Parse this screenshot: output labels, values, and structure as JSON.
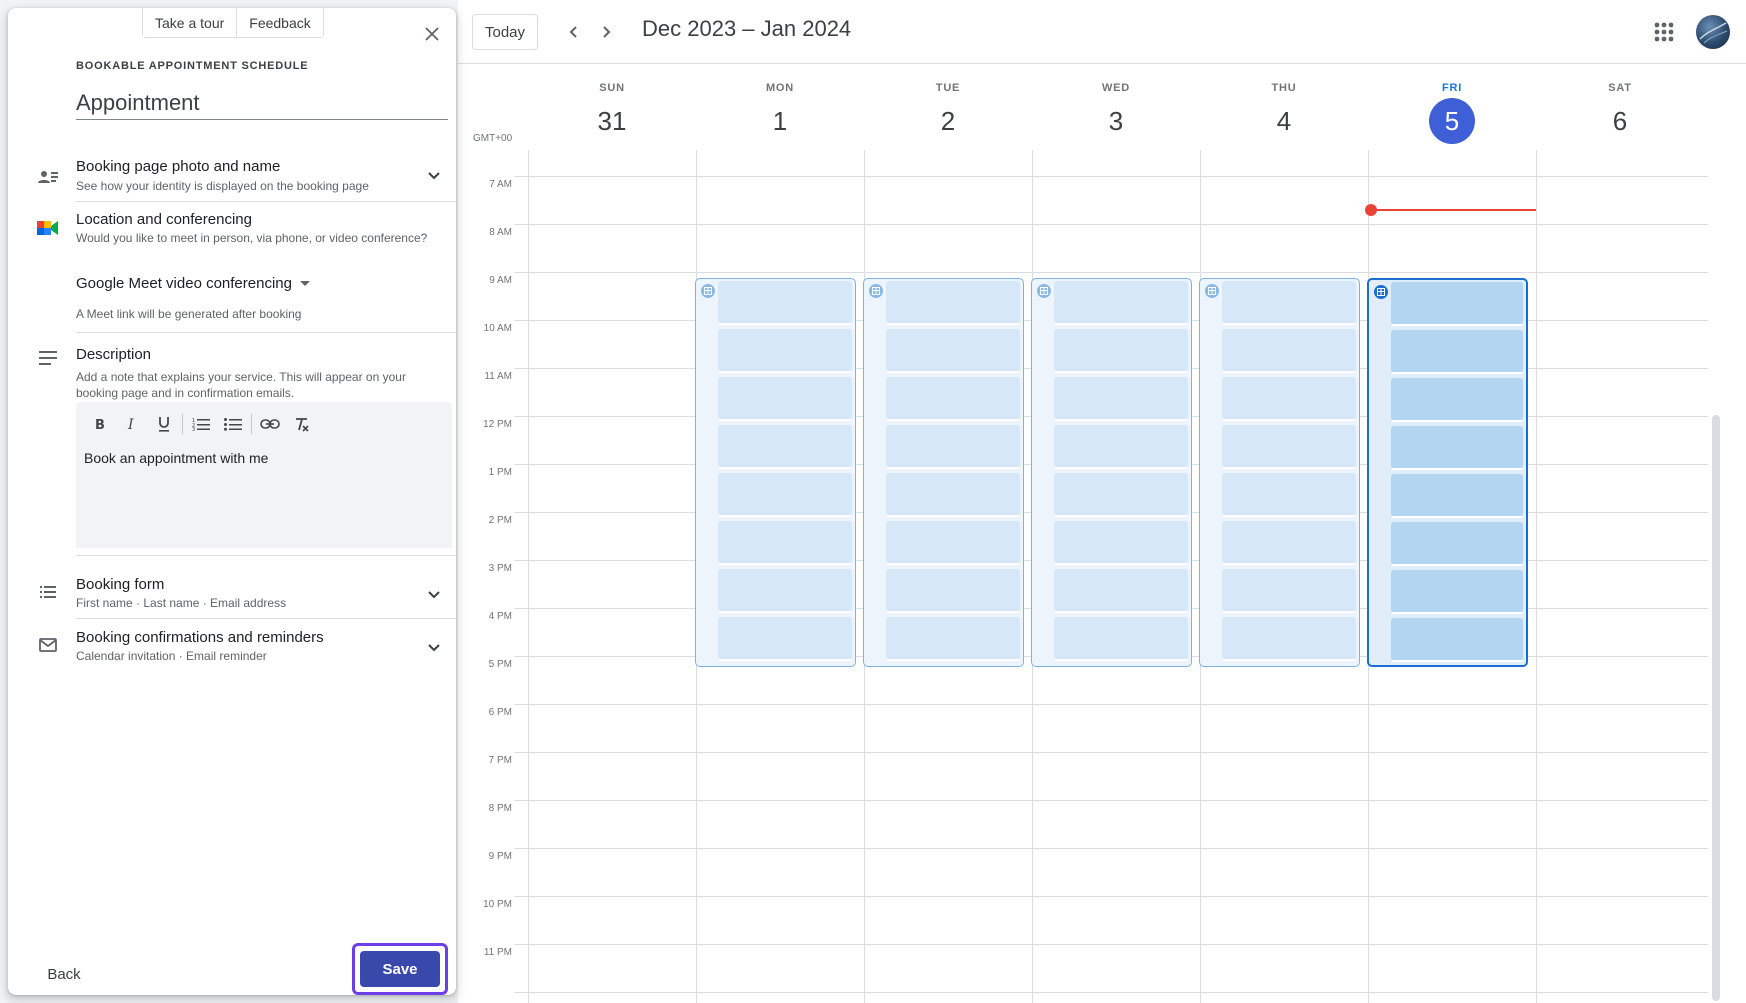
{
  "panel": {
    "tour_label": "Take a tour",
    "feedback_label": "Feedback",
    "eyebrow": "BOOKABLE APPOINTMENT SCHEDULE",
    "title_value": "Appointment",
    "booking_page": {
      "title": "Booking page photo and name",
      "subtitle": "See how your identity is displayed on the booking page"
    },
    "location": {
      "title": "Location and conferencing",
      "subtitle": "Would you like to meet in person, via phone, or video conference?",
      "select_value": "Google Meet video conferencing",
      "note": "A Meet link will be generated after booking"
    },
    "description": {
      "title": "Description",
      "subtitle": "Add a note that explains your service. This will appear on your booking page and in confirmation emails.",
      "text": "Book an appointment with me"
    },
    "booking_form": {
      "title": "Booking form",
      "subtitle": "First name · Last name · Email address"
    },
    "confirmations": {
      "title": "Booking confirmations and reminders",
      "subtitle": "Calendar invitation · Email reminder"
    },
    "back_label": "Back",
    "save_label": "Save"
  },
  "calendar": {
    "today_label": "Today",
    "range_title": "Dec 2023 – Jan 2024",
    "timezone": "GMT+00",
    "days": [
      {
        "name": "SUN",
        "num": "31"
      },
      {
        "name": "MON",
        "num": "1"
      },
      {
        "name": "TUE",
        "num": "2"
      },
      {
        "name": "WED",
        "num": "3"
      },
      {
        "name": "THU",
        "num": "4"
      },
      {
        "name": "FRI",
        "num": "5"
      },
      {
        "name": "SAT",
        "num": "6"
      }
    ],
    "hours": [
      "7 AM",
      "8 AM",
      "9 AM",
      "10 AM",
      "11 AM",
      "12 PM",
      "1 PM",
      "2 PM",
      "3 PM",
      "4 PM",
      "5 PM",
      "6 PM",
      "7 PM",
      "8 PM",
      "9 PM",
      "10 PM",
      "11 PM"
    ]
  },
  "colors": {
    "accent": "#1a73e8",
    "today_circle": "#3f5fd6",
    "now_line": "#ea4335",
    "save_button": "#3949ab",
    "focus_ring": "#6c3ee8"
  }
}
